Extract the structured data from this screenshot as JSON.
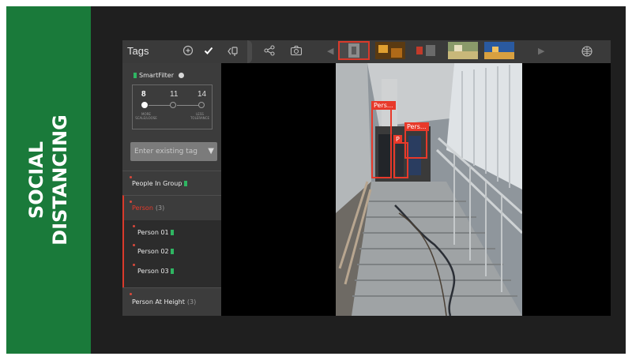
{
  "banner": {
    "title": "SOCIAL\nDISTANCING",
    "color": "#1a7a3a"
  },
  "toolbar": {
    "title": "Tags",
    "icons": [
      "add-circle-icon",
      "checkmark-icon",
      "tag-back-icon",
      "share-icon",
      "camera-icon",
      "globe-icon"
    ],
    "thumbnails_prev": "◀",
    "thumbnails_next": "▶"
  },
  "smartfilter": {
    "label": "SmartFilter",
    "values": [
      "8",
      "11",
      "14"
    ],
    "left_caption": "MORE\nSCALE/LOOSE",
    "right_caption": "LESS\nTOLERANCE"
  },
  "tag_input": {
    "placeholder": "Enter existing tag"
  },
  "tags": [
    {
      "label": "People In Group",
      "count": ""
    },
    {
      "label": "Person",
      "count": "(3)"
    },
    {
      "label": "Person 01",
      "count": ""
    },
    {
      "label": "Person 02",
      "count": ""
    },
    {
      "label": "Person 03",
      "count": ""
    },
    {
      "label": "Person At Height",
      "count": "(3)"
    }
  ],
  "detections": [
    {
      "label": "Pers..."
    },
    {
      "label": "Pers..."
    },
    {
      "label": "P"
    }
  ],
  "colors": {
    "accent_red": "#e8392a",
    "accent_green": "#2fb562",
    "panel_bg": "#3c3c3c"
  }
}
